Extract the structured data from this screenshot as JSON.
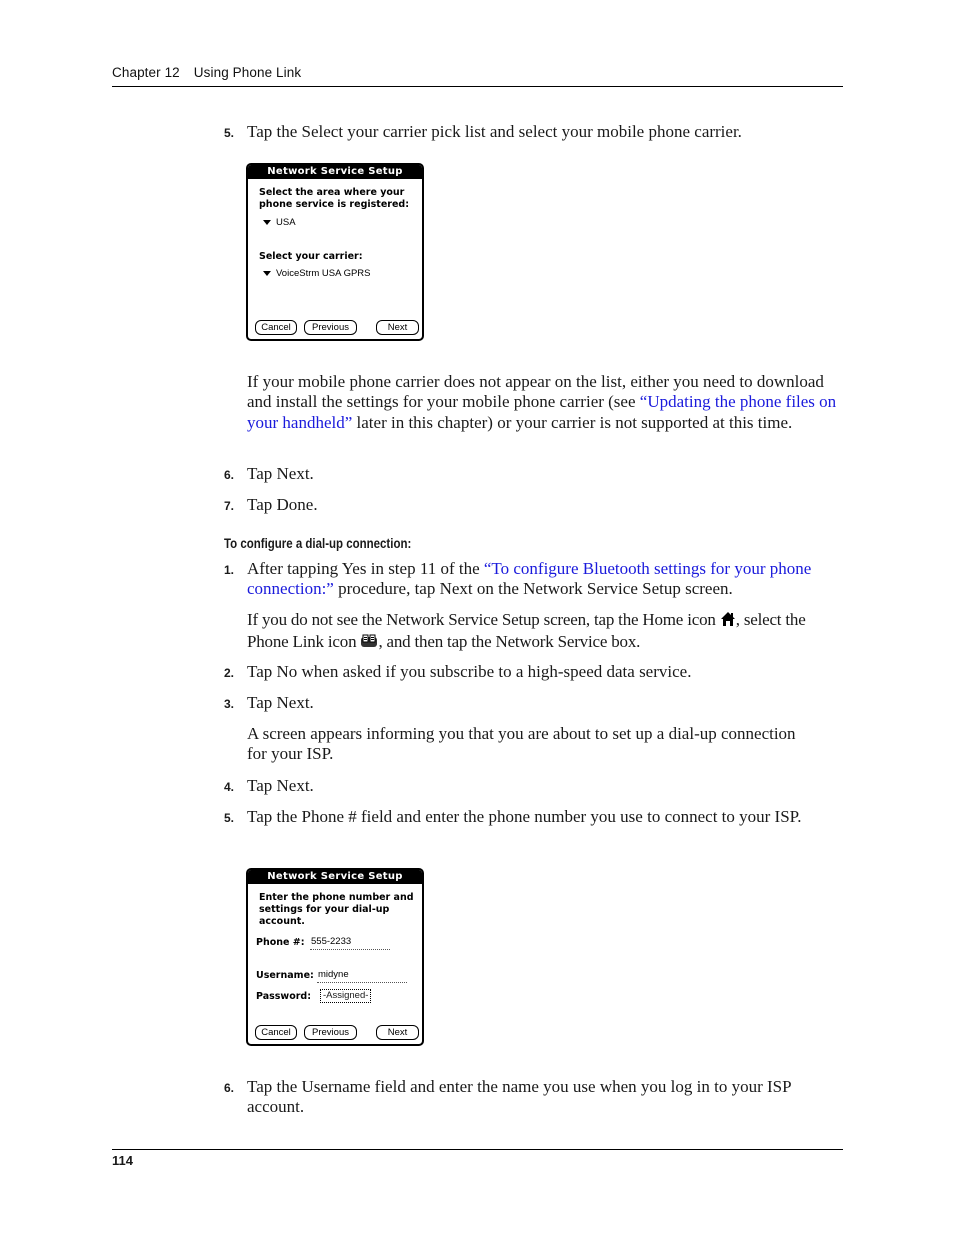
{
  "header": {
    "chapter": "Chapter 12",
    "title": "Using Phone Link"
  },
  "section1": {
    "step5": {
      "num": "5.",
      "text": "Tap the Select your carrier pick list and select your mobile phone carrier."
    },
    "screen1": {
      "title": "Network Service Setup",
      "area_label_line1": "Select the area where your",
      "area_label_line2": "phone service is registered:",
      "area_value": "USA",
      "carrier_label": "Select your carrier:",
      "carrier_value": "VoiceStrm USA GPRS",
      "buttons": {
        "cancel": "Cancel",
        "previous": "Previous",
        "next": "Next"
      }
    },
    "note": {
      "pre": "If your mobile phone carrier does not appear on the list, either you need to download and install the settings for your mobile phone carrier (see ",
      "link": "“Updating the phone files on your handheld”",
      "post": " later in this chapter) or your carrier is not supported at this time."
    },
    "step6": {
      "num": "6.",
      "text": "Tap Next."
    },
    "step7": {
      "num": "7.",
      "text": "Tap Done."
    }
  },
  "section2": {
    "heading": "To configure a dial-up connection:",
    "step1": {
      "num": "1.",
      "pre": "After tapping Yes in step 11 of the ",
      "link": "“To configure Bluetooth settings for your phone connection:”",
      "post": " procedure, tap Next on the Network Service Setup screen."
    },
    "step1_note": {
      "part1": "If you do not see the Network Service Setup screen, tap the Home icon ",
      "part2": ", select the Phone Link icon ",
      "part3": ", and then tap the Network Service box."
    },
    "step2": {
      "num": "2.",
      "text": "Tap No when asked if you subscribe to a high-speed data service."
    },
    "step3": {
      "num": "3.",
      "text": "Tap Next."
    },
    "step3_note": "A screen appears informing you that you are about to set up a dial-up connection for your ISP.",
    "step4": {
      "num": "4.",
      "text": "Tap Next."
    },
    "step5": {
      "num": "5.",
      "text": "Tap the Phone # field and enter the phone number you use to connect to your ISP."
    },
    "screen2": {
      "title": "Network Service Setup",
      "intro_line1": "Enter the phone number and",
      "intro_line2": "settings for your dial-up",
      "intro_line3": "account.",
      "phone_label": "Phone #:",
      "phone_value": "555-2233",
      "username_label": "Username:",
      "username_value": "midyne",
      "password_label": "Password:",
      "password_value": "-Assigned-",
      "buttons": {
        "cancel": "Cancel",
        "previous": "Previous",
        "next": "Next"
      }
    },
    "step6": {
      "num": "6.",
      "text": "Tap the Username field and enter the name you use when you log in to your ISP account."
    }
  },
  "icons": {
    "home": "home-icon",
    "phone_link": "phone-link-icon",
    "dropdown": "triangle-down-icon"
  },
  "colors": {
    "link": "#1a1adc"
  },
  "footer": {
    "page_number": "114"
  }
}
